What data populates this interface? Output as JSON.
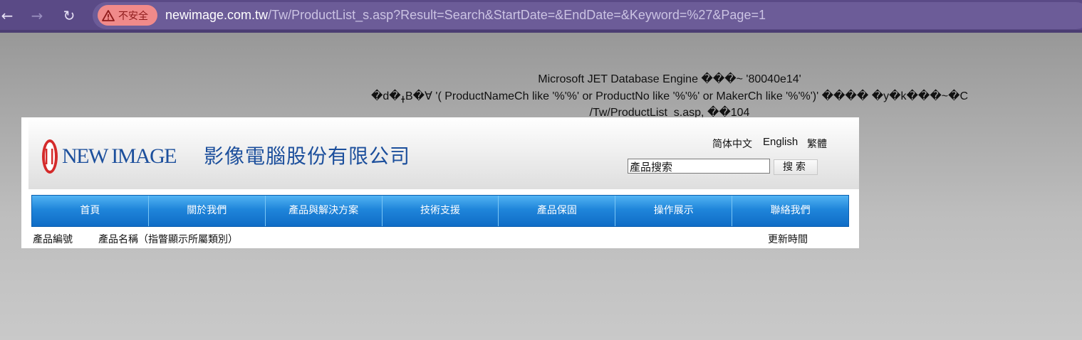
{
  "browser": {
    "security_label": "不安全",
    "url_host": "newimage.com.tw",
    "url_path": "/Tw/ProductList_s.asp?Result=Search&StartDate=&EndDate=&Keyword=%27&Page=1",
    "icons": [
      "back-icon",
      "forward-icon",
      "reload-icon",
      "warning-icon"
    ]
  },
  "error": {
    "line1": "Microsoft JET Database Engine ���~ '80040e14'",
    "line2": "�d�ߪB�∀ '( ProductNameCh like '%'%' or ProductNo like '%'%' or MakerCh like '%'%')' ���� �y�k���~�C",
    "line3": "/Tw/ProductList_s.asp, ��104"
  },
  "site": {
    "logo_en": "NEW IMAGE",
    "logo_zh": "影像電腦股份有限公司",
    "lang_simplified": "简体中文",
    "lang_english": "English",
    "lang_traditional": "繁體",
    "search_value": "產品搜索",
    "search_button": "搜索",
    "menu": [
      "首頁",
      "關於我們",
      "產品與解決方案",
      "技術支援",
      "產品保固",
      "操作展示",
      "聯絡我們"
    ],
    "table_headers": {
      "product_no": "產品編號",
      "product_name": "產品名稱（指瞥顯示所屬類別）",
      "updated": "更新時間"
    },
    "colors": {
      "menu_blue": "#1f85da",
      "logo_blue": "#1c4f9c",
      "logo_red": "#d42a2a"
    }
  }
}
